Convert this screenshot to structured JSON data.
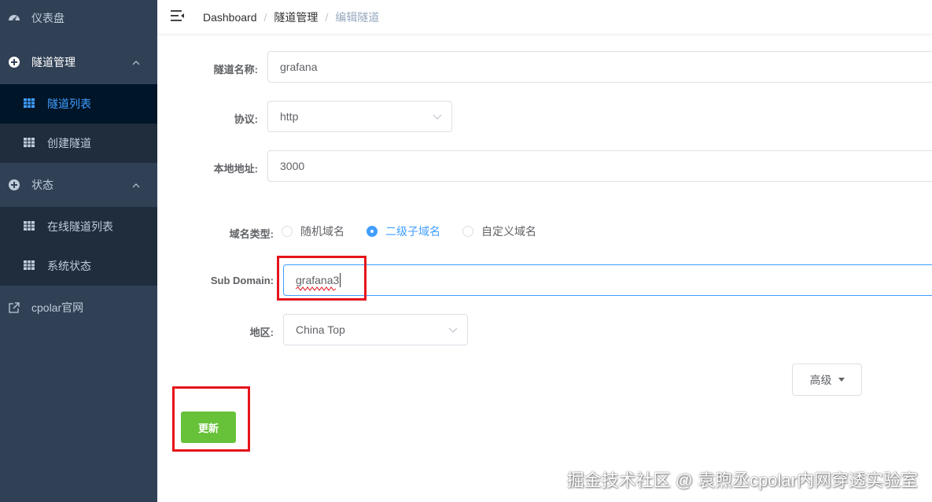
{
  "sidebar": {
    "items": [
      {
        "label": "仪表盘"
      },
      {
        "label": "隧道管理"
      },
      {
        "label": "隧道列表"
      },
      {
        "label": "创建隧道"
      },
      {
        "label": "状态"
      },
      {
        "label": "在线隧道列表"
      },
      {
        "label": "系统状态"
      },
      {
        "label": "cpolar官网"
      }
    ],
    "active_color": "#409eff",
    "bg_color": "#304156"
  },
  "breadcrumb": [
    "Dashboard",
    "隧道管理",
    "编辑隧道"
  ],
  "form": {
    "tunnel_name": {
      "label": "隧道名称:",
      "value": "grafana"
    },
    "protocol": {
      "label": "协议:",
      "value": "http"
    },
    "local_address": {
      "label": "本地地址:",
      "value": "3000"
    },
    "domain_type": {
      "label": "域名类型:",
      "options": [
        "随机域名",
        "二级子域名",
        "自定义域名"
      ],
      "selected": "二级子域名"
    },
    "sub_domain": {
      "label": "Sub Domain:",
      "value": "grafana3"
    },
    "region": {
      "label": "地区:",
      "value": "China Top"
    },
    "advanced_label": "高级",
    "update_label": "更新"
  },
  "watermark": "掘金技术社区 @ 袁煦丞cpolar内网穿透实验室",
  "colors": {
    "primary": "#409eff",
    "success": "#67c23a",
    "highlight": "#e5141b"
  }
}
